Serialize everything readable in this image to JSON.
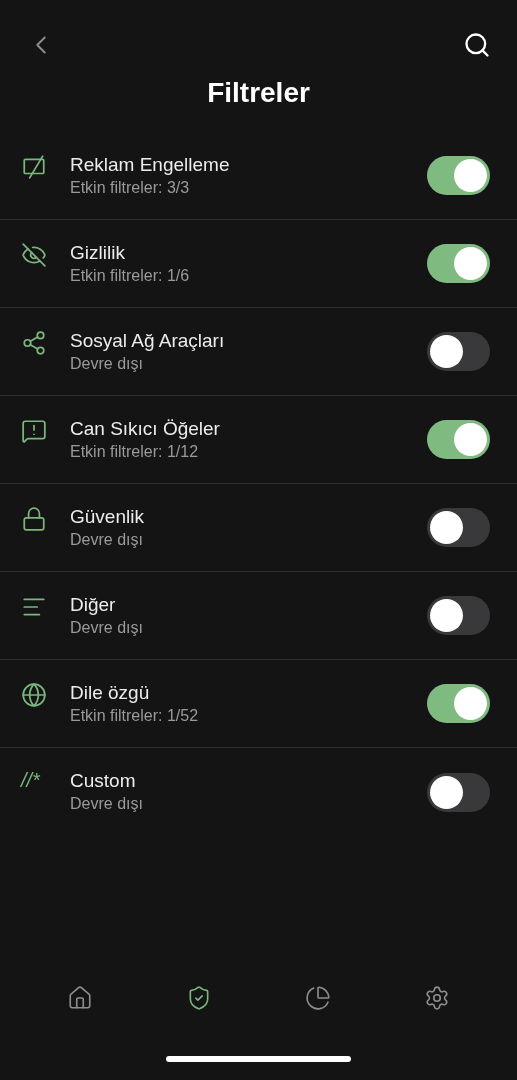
{
  "title": "Filtreler",
  "filters": [
    {
      "kind": "ads",
      "name": "Reklam Engelleme",
      "status": "Etkin filtreler: 3/3",
      "on": true
    },
    {
      "kind": "privacy",
      "name": "Gizlilik",
      "status": "Etkin filtreler: 1/6",
      "on": true
    },
    {
      "kind": "social",
      "name": "Sosyal Ağ Araçları",
      "status": "Devre dışı",
      "on": false
    },
    {
      "kind": "annoyance",
      "name": "Can Sıkıcı Öğeler",
      "status": "Etkin filtreler: 1/12",
      "on": true
    },
    {
      "kind": "security",
      "name": "Güvenlik",
      "status": "Devre dışı",
      "on": false
    },
    {
      "kind": "other",
      "name": "Diğer",
      "status": "Devre dışı",
      "on": false
    },
    {
      "kind": "language",
      "name": "Dile özgü",
      "status": "Etkin filtreler: 1/52",
      "on": true
    },
    {
      "kind": "custom",
      "glyph": "//*",
      "name": "Custom",
      "status": "Devre dışı",
      "on": false
    }
  ],
  "tabs": [
    {
      "kind": "home",
      "selected": false
    },
    {
      "kind": "protection",
      "selected": true
    },
    {
      "kind": "stats",
      "selected": false
    },
    {
      "kind": "settings",
      "selected": false
    }
  ]
}
